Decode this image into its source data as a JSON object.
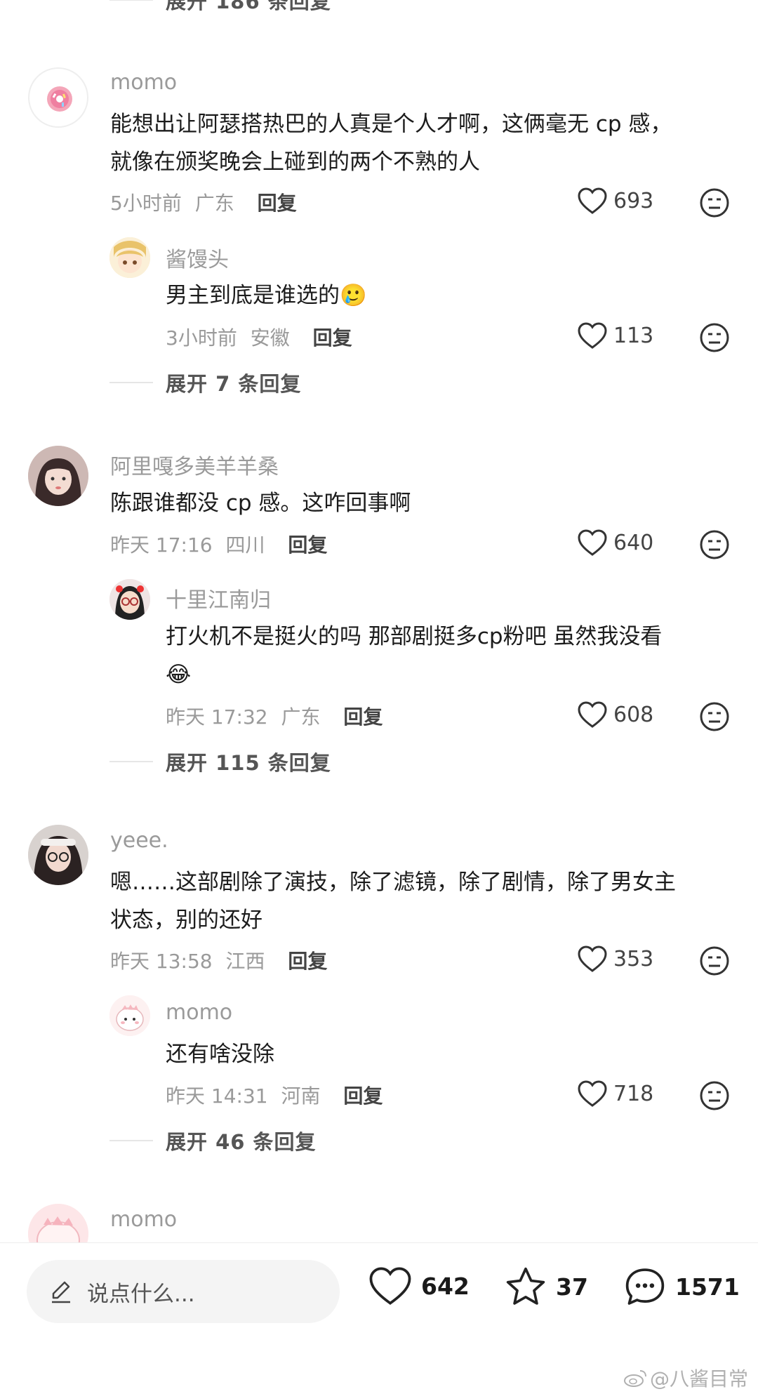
{
  "top_expand": "展开 186 条回复",
  "reply_label": "回复",
  "comments": [
    {
      "user": "momo",
      "text_lines": [
        "能想出让阿瑟搭热巴的人真是个人才啊，这俩毫无 cp 感，",
        "就像在颁奖晚会上碰到的两个不熟的人"
      ],
      "time": "5小时前",
      "location": "广东",
      "likes": "693",
      "reply": {
        "user": "酱馒头",
        "text": "男主到底是谁选的",
        "emoji": "🥲",
        "time": "3小时前",
        "location": "安徽",
        "likes": "113"
      },
      "expand": "展开 7 条回复"
    },
    {
      "user": "阿里嘎多美羊羊桑",
      "text_lines": [
        "陈跟谁都没 cp 感。这咋回事啊"
      ],
      "time": "昨天 17:16",
      "location": "四川",
      "likes": "640",
      "reply": {
        "user": "十里江南归",
        "text": "打火机不是挺火的吗 那部剧挺多cp粉吧 虽然我没看",
        "emoji": "😂",
        "time": "昨天 17:32",
        "location": "广东",
        "likes": "608"
      },
      "expand": "展开 115 条回复"
    },
    {
      "user": "yeee.",
      "text_lines": [
        "嗯……这部剧除了演技，除了滤镜，除了剧情，除了男女主",
        "状态，别的还好"
      ],
      "time": "昨天 13:58",
      "location": "江西",
      "likes": "353",
      "reply": {
        "user": "momo",
        "text": "还有啥没除",
        "emoji": "",
        "time": "昨天 14:31",
        "location": "河南",
        "likes": "718"
      },
      "expand": "展开 46 条回复"
    },
    {
      "user": "momo"
    }
  ],
  "bottom_bar": {
    "placeholder": "说点什么...",
    "likes": "642",
    "favorites": "37",
    "comments": "1571"
  },
  "watermark": "@八酱目常"
}
